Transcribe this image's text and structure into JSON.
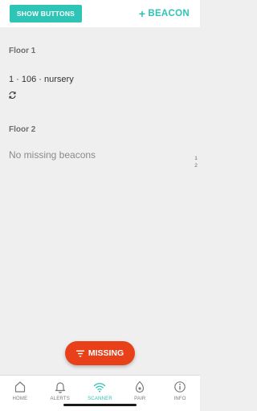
{
  "header": {
    "show_buttons_label": "SHOW BUTTONS",
    "add_beacon_plus": "+",
    "add_beacon_label": "BEACON"
  },
  "floors": [
    {
      "title": "Floor 1",
      "items": [
        {
          "label": "1 · 106 · nursery"
        }
      ]
    },
    {
      "title": "Floor 2",
      "empty_text": "No missing beacons"
    }
  ],
  "index_list": [
    "1",
    "2"
  ],
  "fab": {
    "label": "MISSING"
  },
  "nav": {
    "items": [
      {
        "label": "HOME",
        "icon": "home-icon"
      },
      {
        "label": "ALERTS",
        "icon": "bell-icon"
      },
      {
        "label": "SCANNER",
        "icon": "wifi-icon",
        "active": true
      },
      {
        "label": "PAIR",
        "icon": "beacon-icon"
      },
      {
        "label": "INFO",
        "icon": "info-icon"
      }
    ]
  },
  "colors": {
    "accent": "#2ec4b6",
    "missing": "#e8411a"
  }
}
